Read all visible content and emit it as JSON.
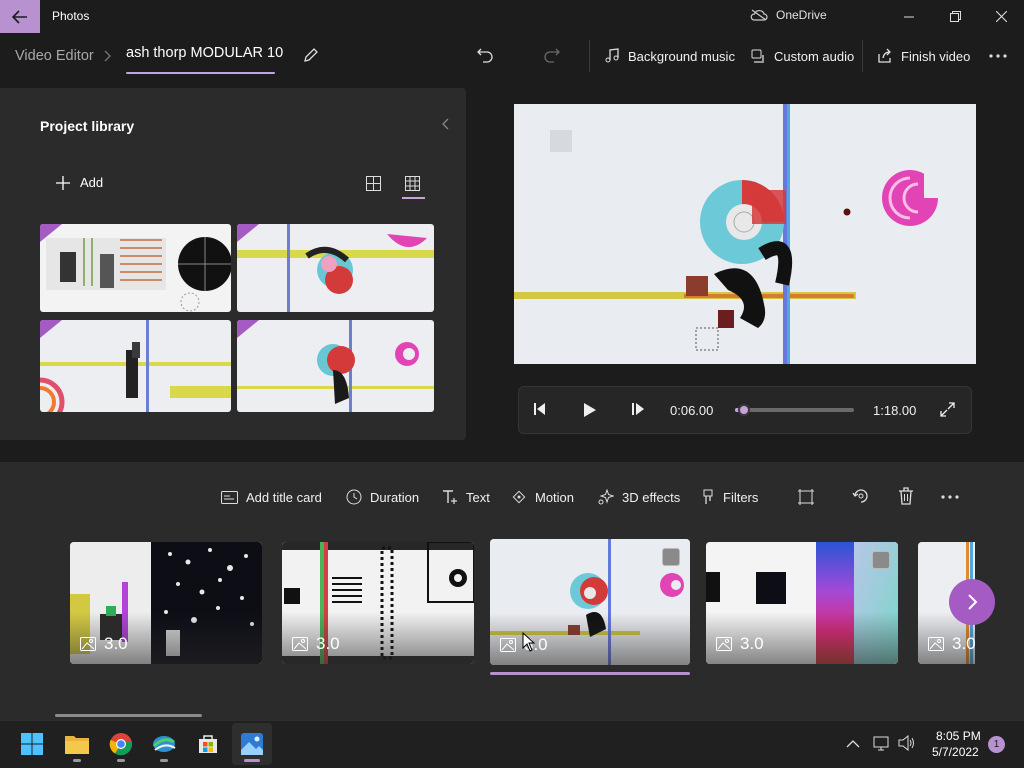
{
  "titlebar": {
    "app_title": "Photos",
    "onedrive_label": "OneDrive"
  },
  "toolbar": {
    "breadcrumb_root": "Video Editor",
    "project_name": "ash thorp MODULAR 10",
    "background_music": "Background music",
    "custom_audio": "Custom audio",
    "finish_video": "Finish video"
  },
  "library": {
    "title": "Project library",
    "add_label": "Add"
  },
  "player": {
    "current_time": "0:06.00",
    "total_time": "1:18.00",
    "progress": 0.077
  },
  "editing": {
    "add_title_card": "Add title card",
    "duration": "Duration",
    "text": "Text",
    "motion": "Motion",
    "effects_3d": "3D effects",
    "filters": "Filters"
  },
  "storyboard": {
    "clips": [
      {
        "duration": "3.0"
      },
      {
        "duration": "3.0"
      },
      {
        "duration": "3.0"
      },
      {
        "duration": "3.0"
      },
      {
        "duration": "3.0"
      }
    ]
  },
  "taskbar": {
    "time": "8:05 PM",
    "date": "5/7/2022",
    "notification_count": "1"
  },
  "colors": {
    "accent": "#b891d1",
    "accent_dark": "#a45cc4"
  }
}
